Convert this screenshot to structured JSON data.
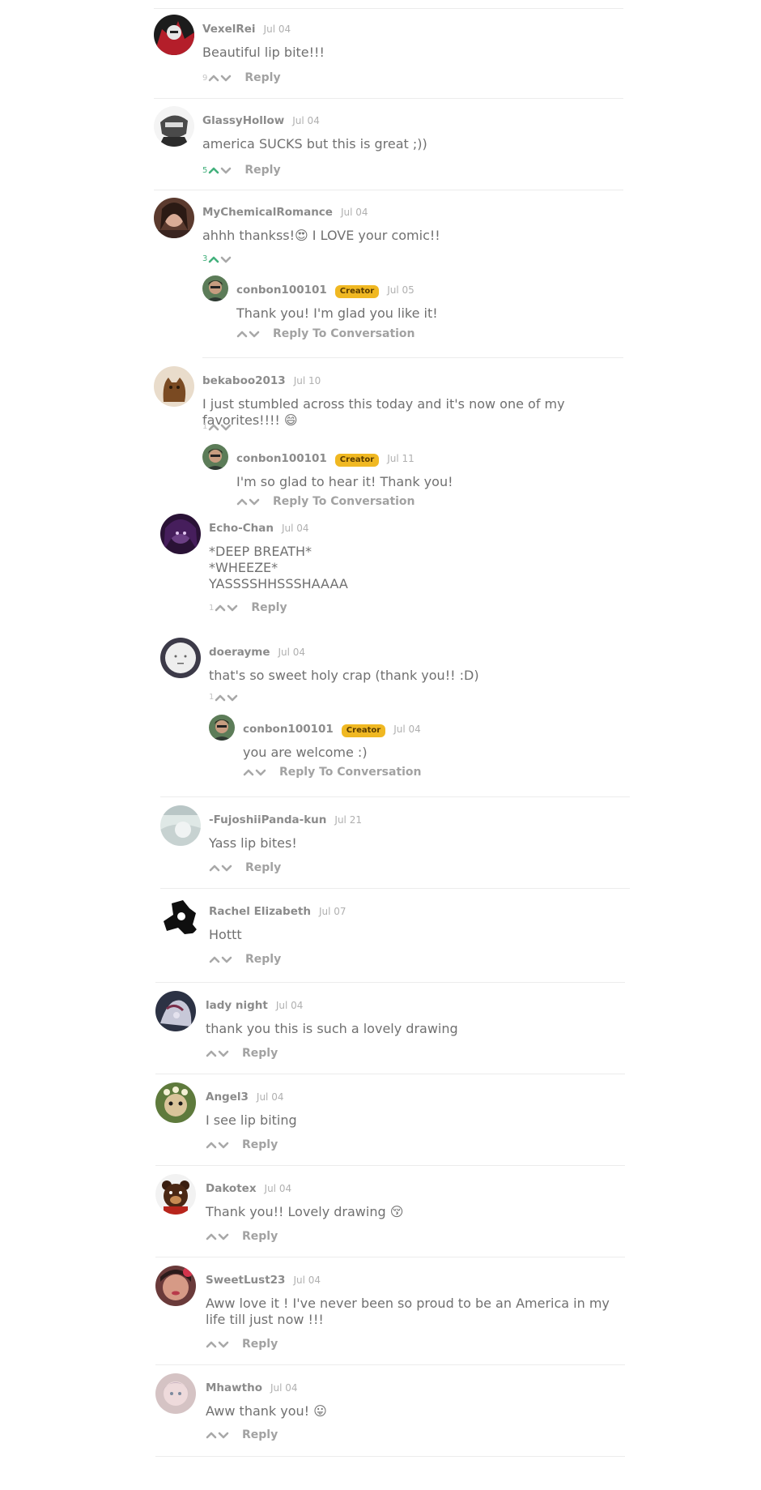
{
  "colors": {
    "upvote_active": "#43b07c",
    "arrow_gray": "#a8a8a8",
    "creator_badge": "#f0b822",
    "divider": "#ececec"
  },
  "icons": {
    "upvote": "chevron-up-icon",
    "downvote": "chevron-down-icon"
  },
  "comments": [
    {
      "user": "VexelRei",
      "date": "Jul 04",
      "text": "Beautiful lip bite!!!",
      "votes": "9",
      "action": "Reply"
    },
    {
      "user": "GlassyHollow",
      "date": "Jul 04",
      "text": "america SUCKS but this is great ;))",
      "votes": "5",
      "upvoted": true,
      "action": "Reply"
    },
    {
      "user": "MyChemicalRomance",
      "date": "Jul 04",
      "text": "ahhh thankss!😍 I LOVE your comic!!",
      "votes": "3",
      "upvoted": true,
      "action": ""
    },
    {
      "user": "conbon100101",
      "badge": "Creator",
      "date": "Jul 05",
      "text": "Thank you! I'm glad you like it!",
      "votes": "",
      "action": "Reply To Conversation"
    },
    {
      "user": "bekaboo2013",
      "date": "Jul 10",
      "text": "I just stumbled across this today and it's now one of my favorites!!!! 😄",
      "votes": "1",
      "action": ""
    },
    {
      "user": "conbon100101",
      "badge": "Creator",
      "date": "Jul 11",
      "text": "I'm so glad to hear it! Thank you!",
      "votes": "",
      "action": "Reply To Conversation"
    },
    {
      "user": "Echo-Chan",
      "date": "Jul 04",
      "text": "*DEEP BREATH*\n*WHEEZE*\nYASSSSHHSSSHAAAA",
      "votes": "1",
      "action": "Reply"
    },
    {
      "user": "doerayme",
      "date": "Jul 04",
      "text": "that's so sweet holy crap (thank you!! :D)",
      "votes": "1",
      "action": ""
    },
    {
      "user": "conbon100101",
      "badge": "Creator",
      "date": "Jul 04",
      "text": "you are welcome :)",
      "votes": "",
      "action": "Reply To Conversation"
    },
    {
      "user": "-FujoshiiPanda-kun",
      "date": "Jul 21",
      "text": "Yass lip bites!",
      "votes": "",
      "action": "Reply"
    },
    {
      "user": "Rachel Elizabeth",
      "date": "Jul 07",
      "text": "Hottt",
      "votes": "",
      "action": "Reply"
    },
    {
      "user": "lady night",
      "date": "Jul 04",
      "text": "thank you this is such a lovely drawing",
      "votes": "",
      "action": "Reply"
    },
    {
      "user": "Angel3",
      "date": "Jul 04",
      "text": "I see lip biting",
      "votes": "",
      "action": "Reply"
    },
    {
      "user": "Dakotex",
      "date": "Jul 04",
      "text": "Thank you!! Lovely drawing 😚",
      "votes": "",
      "action": "Reply"
    },
    {
      "user": "SweetLust23",
      "date": "Jul 04",
      "text": "Aww love it ! I've never been so proud to be an America in my life till just now !!!",
      "votes": "",
      "action": "Reply"
    },
    {
      "user": "Mhawtho",
      "date": "Jul 04",
      "text": "Aww thank you! 😛",
      "votes": "",
      "action": "Reply"
    }
  ]
}
